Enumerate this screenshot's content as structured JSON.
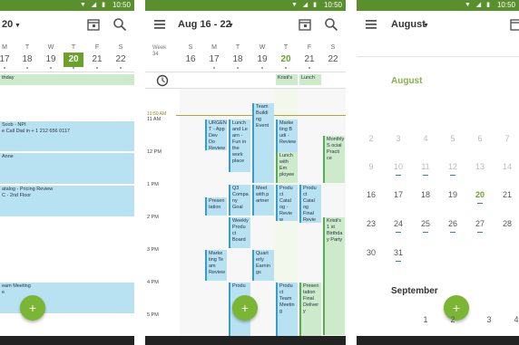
{
  "status": {
    "time": "10:50"
  },
  "p1": {
    "title": "20",
    "week": [
      {
        "l": "M",
        "n": "17"
      },
      {
        "l": "T",
        "n": "18"
      },
      {
        "l": "W",
        "n": "19"
      },
      {
        "l": "T",
        "n": "20"
      },
      {
        "l": "F",
        "n": "21"
      },
      {
        "l": "S",
        "n": "22"
      }
    ],
    "events": [
      {
        "text": "thday",
        "color": "green"
      },
      {
        "text": "Scob - NPI\ne Call Dial in + 1 212 656 0117",
        "color": "blue"
      },
      {
        "text": "Anne",
        "color": "blue"
      },
      {
        "text": "atalog - Pricing Review\nC - 2nd Floor",
        "color": "blue"
      },
      {
        "text": "eam Meeting\ne",
        "color": "blue"
      }
    ],
    "fab": "+"
  },
  "p2": {
    "title": "Aug 16 - 22",
    "week_label": "Week\n34",
    "week": [
      {
        "l": "S",
        "n": "16"
      },
      {
        "l": "M",
        "n": "17"
      },
      {
        "l": "T",
        "n": "18"
      },
      {
        "l": "W",
        "n": "19"
      },
      {
        "l": "T",
        "n": "20"
      },
      {
        "l": "F",
        "n": "21"
      },
      {
        "l": "S",
        "n": "22"
      }
    ],
    "now_label": "10:50 AM",
    "hours": [
      "11 AM",
      "12 PM",
      "1 PM",
      "2 PM",
      "3 PM",
      "4 PM",
      "5 PM"
    ],
    "allday": [
      "Kristi's",
      "Lunch"
    ],
    "events": [
      {
        "text": "URGEN T - App Dev Do Review",
        "color": "blue"
      },
      {
        "text": "Lunch and Le arn - Fun in the work place",
        "color": "blue"
      },
      {
        "text": "Team Buildi ng Event",
        "color": "blue"
      },
      {
        "text": "Marke ting B udi - Review",
        "color": "blue"
      },
      {
        "text": "Lunch with Em ployee",
        "color": "green"
      },
      {
        "text": "Monthly S ocial Practi ce",
        "color": "green"
      },
      {
        "text": "Q3 Compa ny Goal",
        "color": "blue"
      },
      {
        "text": "Meet with p artner",
        "color": "blue"
      },
      {
        "text": "Produ ct Catal og - Revie w",
        "color": "blue"
      },
      {
        "text": "Presen tation",
        "color": "blue"
      },
      {
        "text": "Weekly Produ ct Board",
        "color": "blue"
      },
      {
        "text": "Produ ct Catal og Final Revie w",
        "color": "blue"
      },
      {
        "text": "Kristi's 1 st Birthda y Party",
        "color": "green"
      },
      {
        "text": "Marke ting Te am Review",
        "color": "blue"
      },
      {
        "text": "Quart erly Earnin gs",
        "color": "blue"
      },
      {
        "text": "Produ ct Team Meetin g",
        "color": "blue"
      },
      {
        "text": "Presen tation Final Deliver y",
        "color": "green"
      },
      {
        "text": "Produ",
        "color": "blue"
      }
    ],
    "fab": "+"
  },
  "p3": {
    "title": "August",
    "month1": "August",
    "month2": "September",
    "rows": [
      [
        "2",
        "3",
        "4",
        "5",
        "6",
        "7",
        "8"
      ],
      [
        "9",
        "10",
        "11",
        "12",
        "13",
        "14",
        "15"
      ],
      [
        "16",
        "17",
        "18",
        "19",
        "20",
        "21",
        "22"
      ],
      [
        "23",
        "24",
        "25",
        "26",
        "27",
        "28",
        "29"
      ],
      [
        "30",
        "31"
      ]
    ],
    "sep_row": [
      "1",
      "2",
      "3",
      "4"
    ],
    "today": "20",
    "fab": "+"
  }
}
